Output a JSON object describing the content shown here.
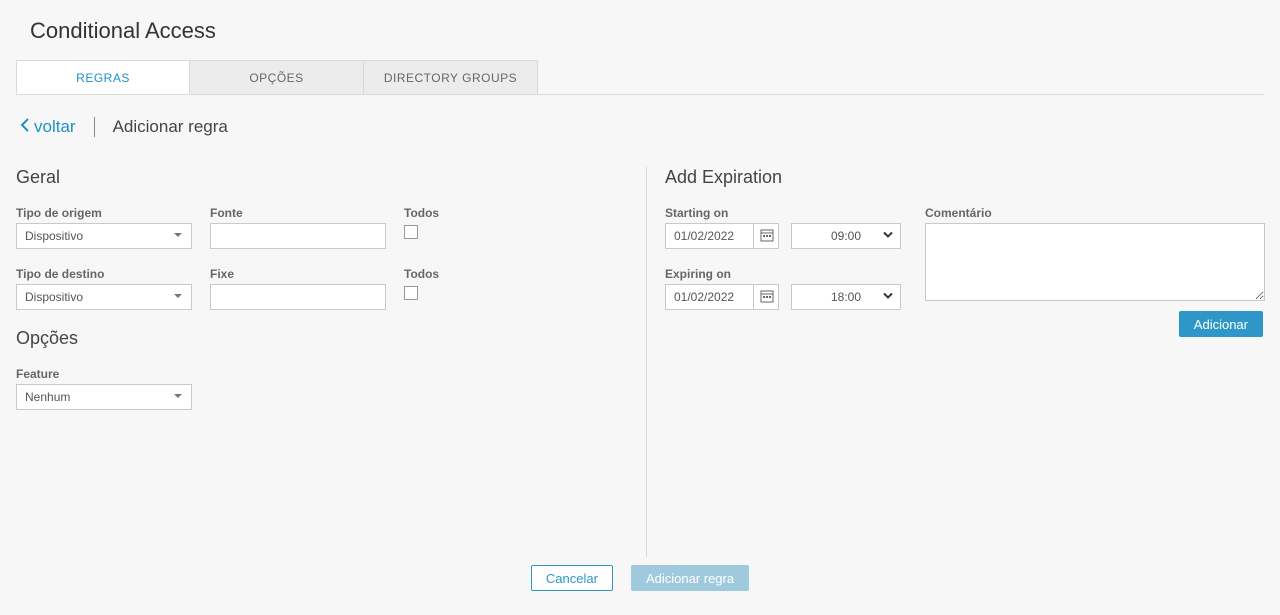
{
  "page": {
    "title": "Conditional Access"
  },
  "tabs": {
    "regras": "REGRAS",
    "opcoes": "OPÇÕES",
    "directory_groups": "DIRECTORY GROUPS"
  },
  "crumb": {
    "back": "voltar",
    "current": "Adicionar regra"
  },
  "general": {
    "heading": "Geral",
    "origin_type_label": "Tipo de origem",
    "origin_type_value": "Dispositivo",
    "fonte_label": "Fonte",
    "fonte_value": "",
    "todos1_label": "Todos",
    "dest_type_label": "Tipo de destino",
    "dest_type_value": "Dispositivo",
    "fixe_label": "Fixe",
    "fixe_value": "",
    "todos2_label": "Todos"
  },
  "options": {
    "heading": "Opções",
    "feature_label": "Feature",
    "feature_value": "Nenhum"
  },
  "expiration": {
    "heading": "Add Expiration",
    "starting_label": "Starting on",
    "starting_date": "01/02/2022",
    "starting_time": "09:00",
    "expiring_label": "Expiring on",
    "expiring_date": "01/02/2022",
    "expiring_time": "18:00",
    "comment_label": "Comentário",
    "comment_value": "",
    "add_button": "Adicionar"
  },
  "footer": {
    "cancel": "Cancelar",
    "submit": "Adicionar regra"
  }
}
